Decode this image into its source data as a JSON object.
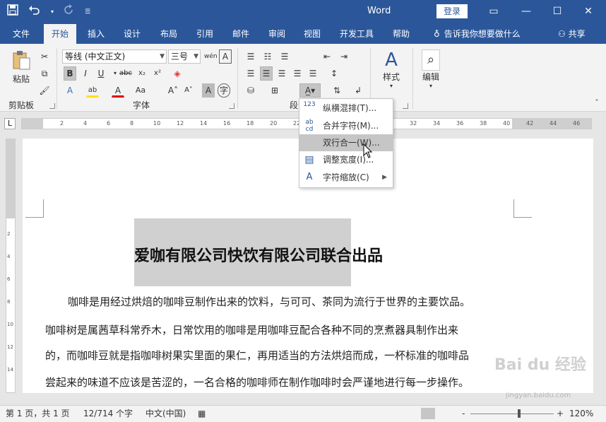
{
  "titlebar": {
    "app_title": "Word",
    "login_label": "登录",
    "qat": {
      "save_icon": "save-icon",
      "undo_icon": "undo-icon",
      "redo_icon": "redo-icon",
      "customize_icon": "customize-qat-icon"
    }
  },
  "tabs": [
    {
      "label": "文件"
    },
    {
      "label": "开始"
    },
    {
      "label": "插入"
    },
    {
      "label": "设计"
    },
    {
      "label": "布局"
    },
    {
      "label": "引用"
    },
    {
      "label": "邮件"
    },
    {
      "label": "审阅"
    },
    {
      "label": "视图"
    },
    {
      "label": "开发工具"
    },
    {
      "label": "帮助"
    }
  ],
  "tellme": "告诉我你想要做什么",
  "share": "共享",
  "ribbon": {
    "clipboard": {
      "group_label": "剪贴板",
      "paste_label": "粘贴"
    },
    "font": {
      "group_label": "字体",
      "font_name": "等线 (中文正文)",
      "font_size": "三号"
    },
    "paragraph": {
      "group_label": "段落"
    },
    "styles": {
      "label": "样式"
    },
    "editing": {
      "label": "编辑"
    }
  },
  "ruler": {
    "tab_selector": "L",
    "ticks": [
      "2",
      "4",
      "6",
      "8",
      "10",
      "12",
      "14",
      "16",
      "18",
      "20",
      "22",
      "24",
      "26",
      "28",
      "30",
      "32",
      "34",
      "36",
      "38",
      "40",
      "42",
      "44",
      "46"
    ],
    "vticks": [
      "2",
      "4",
      "6",
      "8",
      "10",
      "12",
      "14"
    ]
  },
  "dropdown": {
    "items": [
      {
        "label": "纵横混排(T)...",
        "icon": "vertical-horizontal-mix-icon",
        "icon_text": "123"
      },
      {
        "label": "合并字符(M)...",
        "icon": "combine-characters-icon",
        "icon_text": "ab cd"
      },
      {
        "label": "双行合一(W)...",
        "icon": "two-lines-in-one-icon",
        "icon_text": ""
      },
      {
        "label": "调整宽度(I)...",
        "icon": "adjust-width-icon",
        "icon_text": ""
      },
      {
        "label": "字符缩放(C)",
        "icon": "character-scale-icon",
        "icon_text": ""
      }
    ],
    "highlighted_index": 2
  },
  "document": {
    "title": "爱咖有限公司快饮有限公司联合出品",
    "paragraphs": [
      "咖啡是用经过烘焙的咖啡豆制作出来的饮料，与可可、茶同为流行于世界的主要饮品。",
      "咖啡树是属茜草科常乔木，日常饮用的咖啡是用咖啡豆配合各种不同的烹煮器具制作出来",
      "的，而咖啡豆就是指咖啡树果实里面的果仁，再用适当的方法烘焙而成，一杯标准的咖啡品",
      "尝起来的味道不应该是苦涩的，一名合格的咖啡师在制作咖啡时会严谨地进行每一步操作。"
    ]
  },
  "statusbar": {
    "page": "第 1 页，共 1 页",
    "words": "12/714 个字",
    "language": "中文(中国)",
    "zoom": "120%",
    "zoom_minus": "-",
    "zoom_plus": "+"
  },
  "watermark": {
    "text": "Bai du 经验",
    "url": "jingyan.baidu.com"
  },
  "colors": {
    "accent": "#2b579a",
    "ribbon_bg": "#f3f3f3",
    "highlight": "#c6c6c6"
  }
}
